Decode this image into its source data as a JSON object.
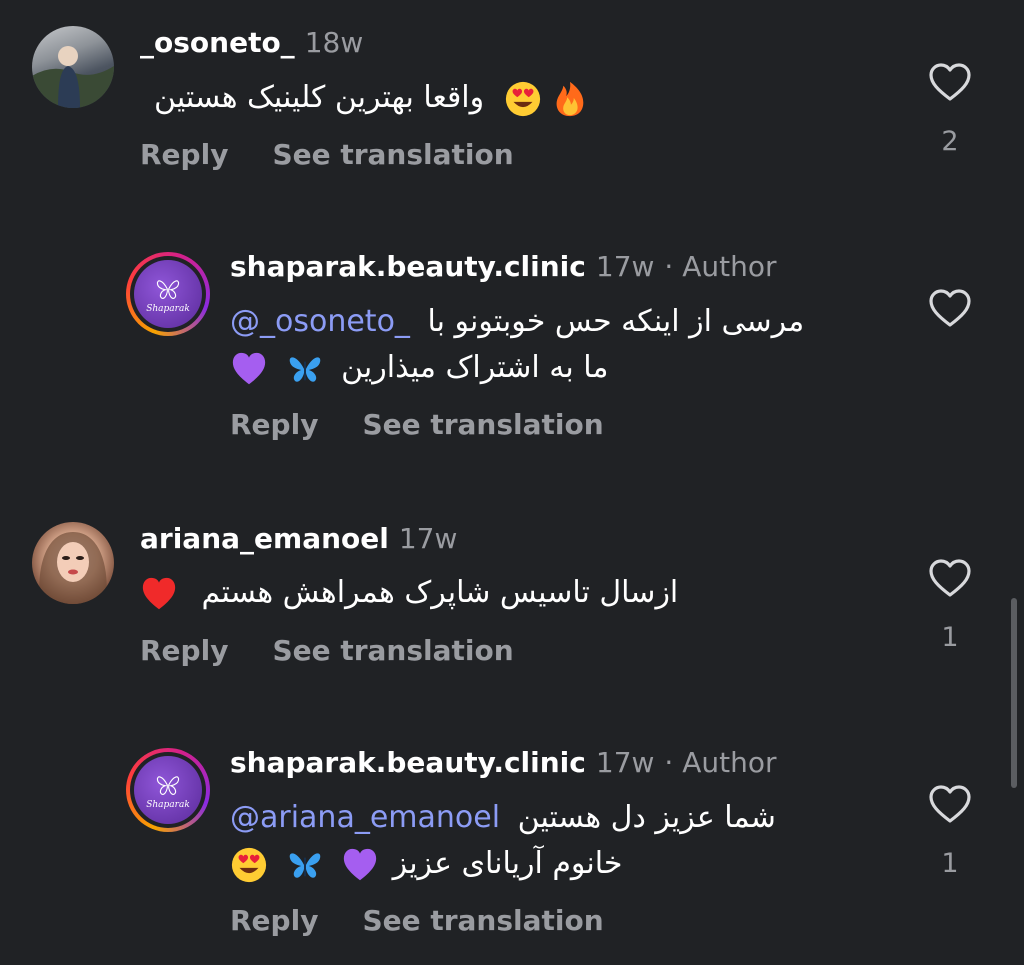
{
  "comments": [
    {
      "username": "_osoneto_",
      "time": "18w",
      "author_tag": "",
      "text_line1": "واقعا بهترین کلینیک هستین",
      "text_line2": "",
      "mention": "",
      "reply_label": "Reply",
      "translate_label": "See translation",
      "likes": "2"
    },
    {
      "username": "shaparak.beauty.clinic",
      "time": "17w",
      "author_tag": "· Author",
      "text_line1": "مرسی از اینکه حس خوبتونو با",
      "mention": "@_osoneto_",
      "text_line2": "ما به اشتراک میذارین",
      "reply_label": "Reply",
      "translate_label": "See translation",
      "likes": ""
    },
    {
      "username": "ariana_emanoel",
      "time": "17w",
      "author_tag": "",
      "text_line1": "ازسال تاسیس شاپرک همراهش هستم",
      "text_line2": "",
      "mention": "",
      "reply_label": "Reply",
      "translate_label": "See translation",
      "likes": "1"
    },
    {
      "username": "shaparak.beauty.clinic",
      "time": "17w",
      "author_tag": "· Author",
      "text_line1": "شما عزیز دل هستین",
      "mention": "@ariana_emanoel",
      "text_line2": "خانوم آریانای عزیز",
      "reply_label": "Reply",
      "translate_label": "See translation",
      "likes": "1"
    }
  ],
  "logo_text": "Shaparak",
  "icons": {
    "like": "heart-outline-icon",
    "fire": "fire-emoji",
    "heart_eyes": "heart-eyes-emoji",
    "butterfly": "butterfly-emoji",
    "purple_heart": "purple-heart-emoji",
    "red_heart": "red-heart-emoji"
  },
  "colors": {
    "background": "#202225",
    "secondary_text": "#9a9ca1",
    "mention": "#8c9cf5"
  }
}
